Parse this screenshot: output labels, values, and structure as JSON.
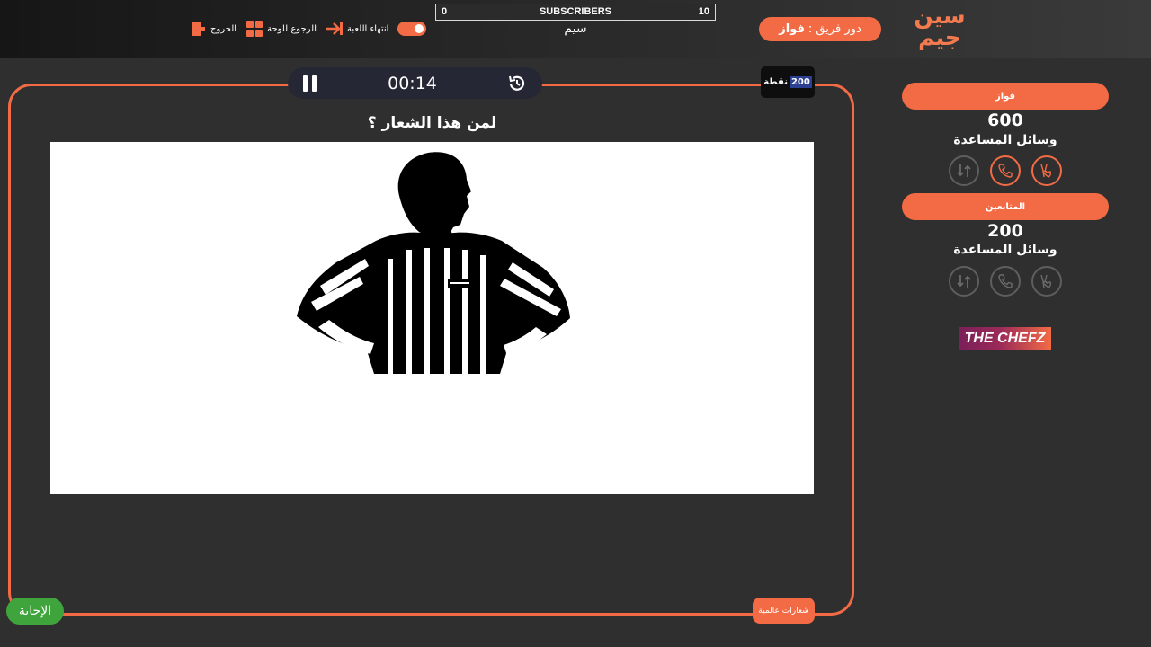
{
  "brand": {
    "logo_text": "سين جيم"
  },
  "header": {
    "turn_label": "دور فريق :",
    "turn_team": "فواز",
    "subscribers": {
      "left": "0",
      "center": "SUBSCRIBERS",
      "right": "10",
      "name": "سيم"
    },
    "actions": {
      "end_game": "انتهاء اللعبة",
      "back_to_board": "الرجوع للوحة",
      "exit": "الخروج"
    }
  },
  "game": {
    "timer": "00:14",
    "points_value": "200",
    "points_label": "نقطة",
    "question": "لمن هذا الشعار ؟",
    "answer_button": "الإجابة",
    "category": "شعارات عالمية"
  },
  "teams": [
    {
      "name": "فواز",
      "score": "600",
      "help_label": "وسائل المساعدة",
      "active": true
    },
    {
      "name": "المتابعين",
      "score": "200",
      "help_label": "وسائل المساعدة",
      "active": false
    }
  ],
  "sponsor": {
    "text": "THE CHEFZ"
  },
  "colors": {
    "accent": "#f26b45",
    "answer": "#3fa43c",
    "background": "#2f2f2f"
  },
  "icons": [
    "pause-icon",
    "restart-timer-icon",
    "two-answers-icon",
    "call-friend-icon",
    "swap-icon"
  ]
}
